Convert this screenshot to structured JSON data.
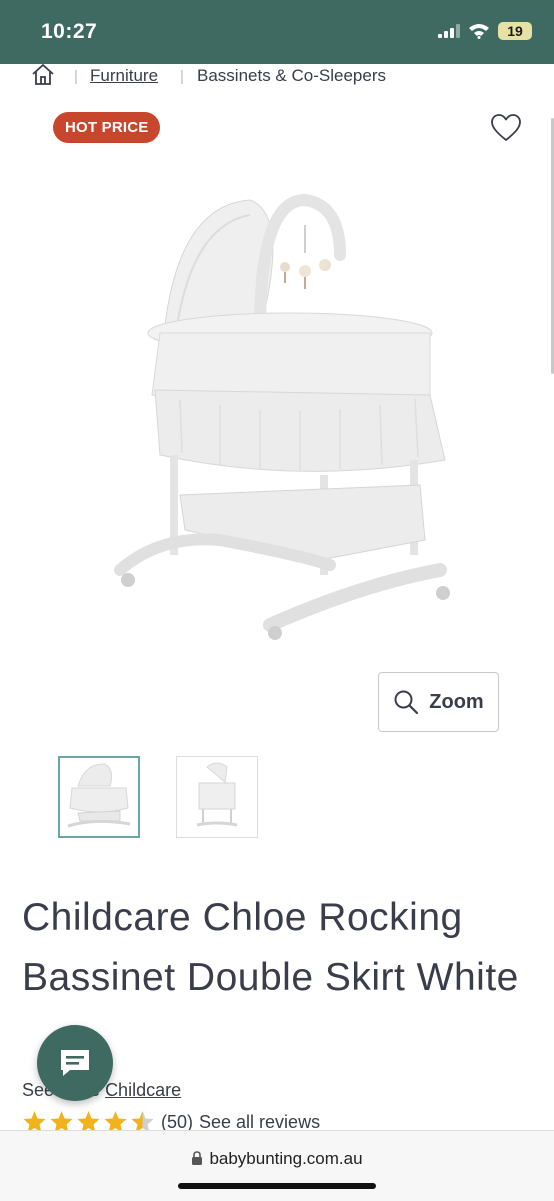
{
  "status": {
    "time": "10:27",
    "battery": "19"
  },
  "breadcrumb": {
    "home_icon": "home-icon",
    "items": [
      "Furniture",
      "Bassinets & Co-Sleepers"
    ]
  },
  "badge": {
    "label": "HOT PRICE",
    "color": "#c8462d"
  },
  "product": {
    "title": "Childcare Chloe Rocking Bassinet Double Skirt White",
    "brand_prefix": "See more",
    "brand": "Childcare",
    "rating": 4.5,
    "rating_count": "(50)",
    "reviews_link": "See all reviews"
  },
  "zoom": {
    "label": "Zoom",
    "icon": "search-icon"
  },
  "thumbnails": [
    {
      "selected": true
    },
    {
      "selected": false
    }
  ],
  "browser": {
    "url": "babybunting.com.au"
  },
  "colors": {
    "brand": "#3f6a62",
    "accent_thumb": "#6aa6a3",
    "star": "#f2b21a"
  }
}
